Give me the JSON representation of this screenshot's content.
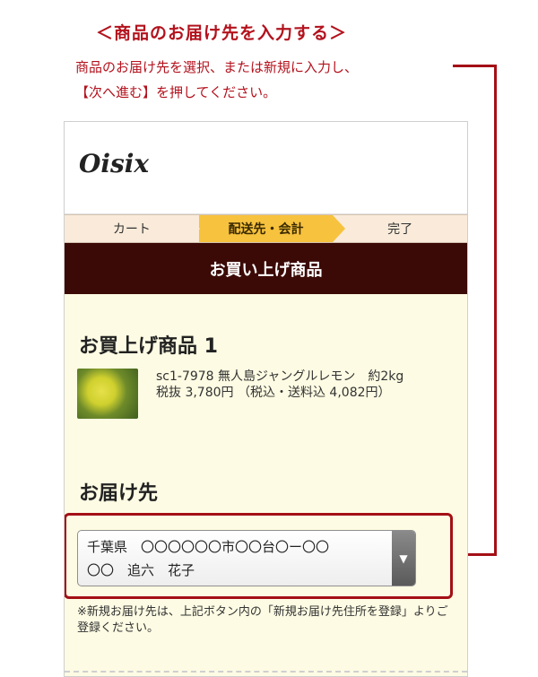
{
  "annotation": {
    "heading": "＜商品のお届け先を入力する＞",
    "instruction_line1": "商品のお届け先を選択、または新規に入力し、",
    "instruction_line2": "【次へ進む】を押してください。"
  },
  "app": {
    "logo": "Oisix"
  },
  "steps": [
    "カート",
    "配送先・会計",
    "完了"
  ],
  "page_title": "お買い上げ商品",
  "purchase": {
    "title": "お買上げ商品 1",
    "item": {
      "line1": "sc1-7978 無人島ジャングルレモン　約2kg",
      "line2": "税抜 3,780円 （税込・送料込 4,082円）"
    }
  },
  "delivery": {
    "title": "お届け先",
    "selected_line1": "千葉県　〇〇〇〇〇〇市〇〇台〇ー〇〇",
    "selected_line2": "〇〇　追六　花子",
    "note": "※新規お届け先は、上記ボタン内の「新規お届け先住所を登録」よりご登録ください。"
  },
  "colors": {
    "annotation_red": "#b3121d",
    "active_step": "#f7c23d",
    "title_bar": "#3c0a06",
    "background": "#fdfbe3"
  }
}
